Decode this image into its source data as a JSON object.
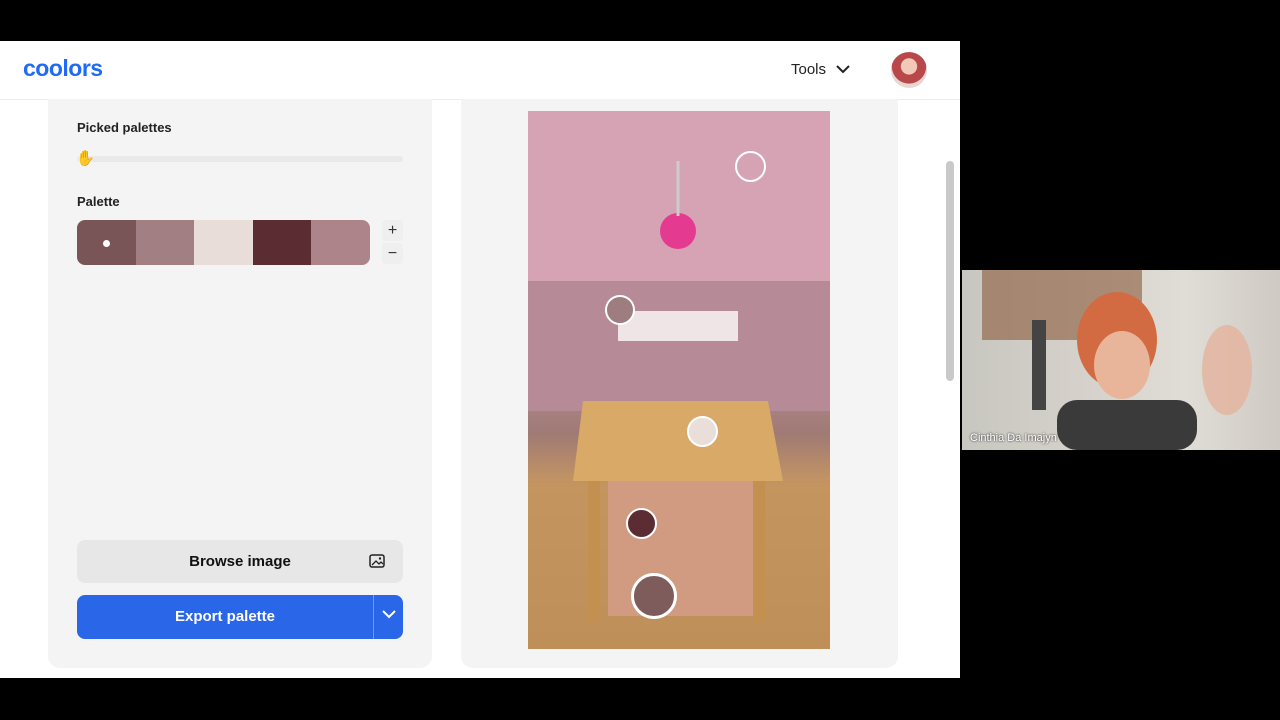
{
  "app": {
    "logo": "coolors",
    "tools_label": "Tools"
  },
  "left": {
    "picked_palettes_label": "Picked palettes",
    "palette_label": "Palette",
    "swatches": [
      "#7a5557",
      "#a27f83",
      "#e8ddd8",
      "#5c2c33",
      "#ad8489"
    ],
    "plus": "+",
    "minus": "−",
    "browse_label": "Browse image",
    "export_label": "Export palette"
  },
  "pickers": [
    {
      "color": "transparent"
    },
    {
      "color": "#9d7d7f"
    },
    {
      "color": "#e9ded9"
    },
    {
      "color": "#5c2c33"
    },
    {
      "color": "#7d5c5b"
    }
  ],
  "video": {
    "participant_name": "Cinthia Da Imajyn"
  },
  "colors": {
    "accent": "#2a66e8",
    "logo": "#1f6bf5"
  }
}
